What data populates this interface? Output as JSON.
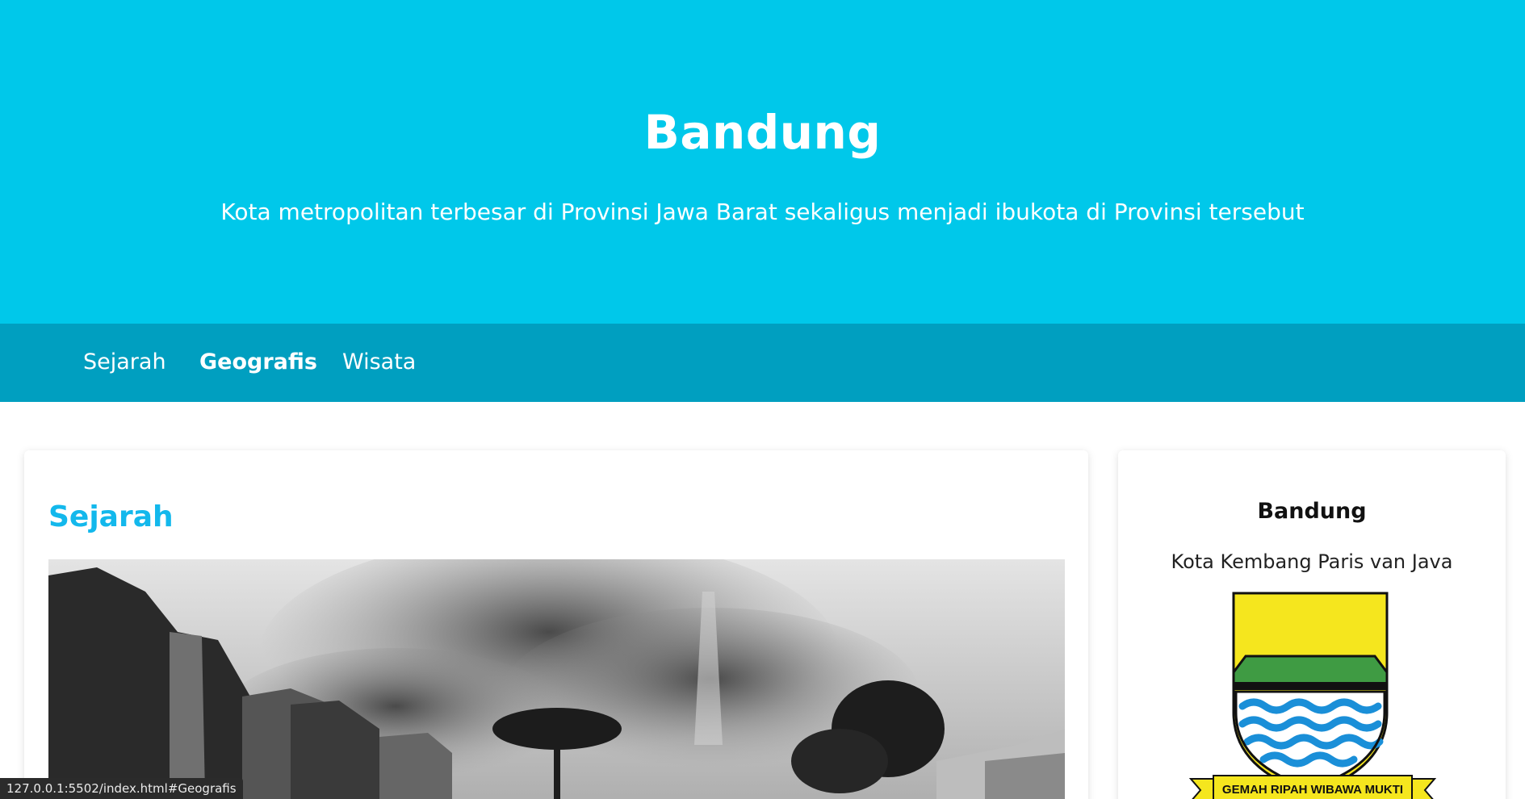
{
  "header": {
    "title": "Bandung",
    "subtitle": "Kota metropolitan terbesar di Provinsi Jawa Barat sekaligus menjadi ibukota di Provinsi tersebut"
  },
  "nav": {
    "items": [
      {
        "label": "Sejarah",
        "active": false
      },
      {
        "label": "Geografis",
        "active": true
      },
      {
        "label": "Wisata",
        "active": false
      }
    ]
  },
  "main": {
    "section_title": "Sejarah",
    "image": "black-and-white historical street photo"
  },
  "aside": {
    "title": "Bandung",
    "subtitle": "Kota Kembang Paris van Java",
    "emblem_motto": "GEMAH RIPAH WIBAWA MUKTI"
  },
  "status_bar": {
    "url": "127.0.0.1:5502/index.html#Geografis"
  },
  "colors": {
    "header_bg": "#00c8ea",
    "nav_bg": "#009fc0",
    "accent": "#13b8ec",
    "emblem_yellow": "#f5e61e",
    "emblem_green": "#3f9b43",
    "emblem_blue": "#1a8fd8"
  }
}
